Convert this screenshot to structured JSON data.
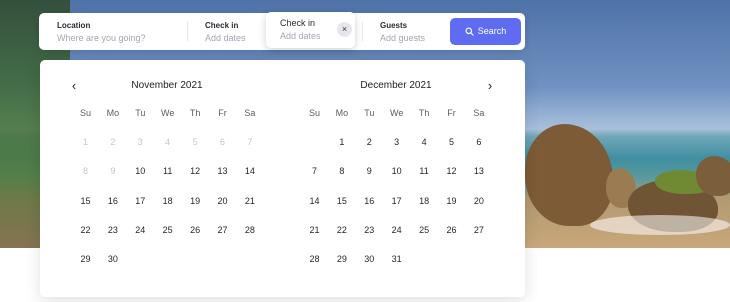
{
  "search": {
    "location_label": "Location",
    "location_placeholder": "Where are you going?",
    "checkin_label": "Check in",
    "checkin_placeholder": "Add dates",
    "checkout_label": "Check in",
    "checkout_placeholder": "Add dates",
    "clear_glyph": "×",
    "guests_label": "Guests",
    "guests_placeholder": "Add guests",
    "search_label": "Search"
  },
  "calendar": {
    "prev_glyph": "‹",
    "next_glyph": "›",
    "weekdays": [
      "Su",
      "Mo",
      "Tu",
      "We",
      "Th",
      "Fr",
      "Sa"
    ],
    "months": [
      {
        "title": "November 2021",
        "start_offset": 0,
        "days": 30,
        "disabled_through": 9
      },
      {
        "title": "December 2021",
        "start_offset": 1,
        "days": 31,
        "disabled_through": 0
      }
    ]
  },
  "colors": {
    "accent": "#5f6cf2",
    "disabled_day": "#c4c6cc"
  }
}
